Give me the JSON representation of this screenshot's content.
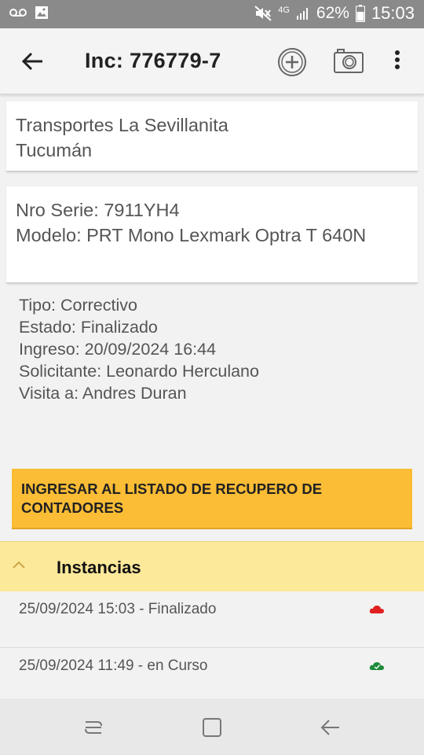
{
  "status_bar": {
    "battery_pct": "62%",
    "time": "15:03",
    "network": "4G"
  },
  "app_bar": {
    "title": "Inc: 776779-7",
    "icons": [
      "back-arrow-icon",
      "add-circle-icon",
      "camera-icon",
      "more-vert-icon"
    ]
  },
  "client": {
    "name": "Transportes La Sevillanita",
    "location": "Tucumán"
  },
  "device": {
    "serial": "Nro Serie: 7911YH4",
    "model": "Modelo: PRT Mono Lexmark Optra T 640N"
  },
  "details": {
    "tipo": "Tipo: Correctivo",
    "estado": "Estado: Finalizado",
    "ingreso": "Ingreso: 20/09/2024 16:44",
    "solicitante": "Solicitante: Leonardo Herculano",
    "visita": "Visita a: Andres Duran"
  },
  "counter_button": {
    "label": "INGRESAR AL LISTADO DE RECUPERO DE CONTADORES",
    "color": "#fbbd35"
  },
  "instancias": {
    "title": "Instancias",
    "items": [
      {
        "label": "25/09/2024 15:03 - Finalizado",
        "cloud_color": "#e02020"
      },
      {
        "label": "25/09/2024 11:49 - en Curso",
        "cloud_color": "#1f8a3a"
      }
    ]
  }
}
